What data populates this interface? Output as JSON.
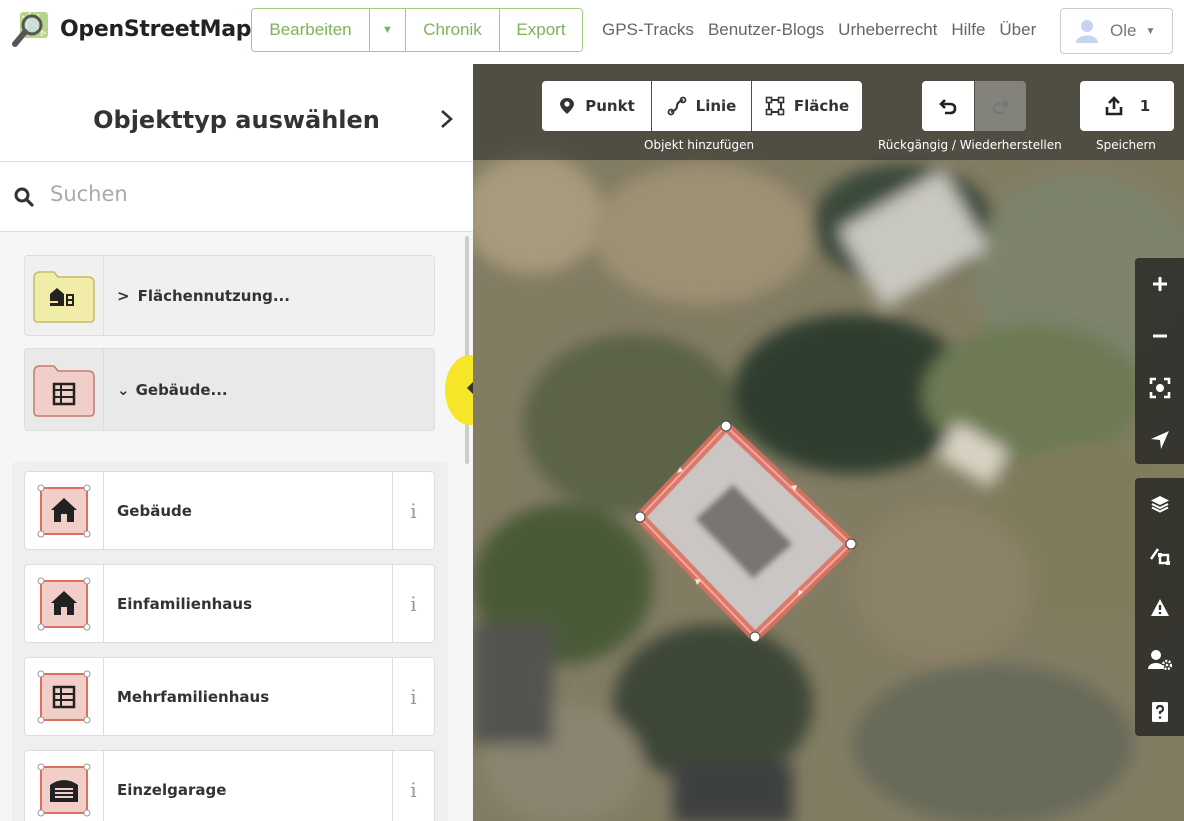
{
  "app": {
    "logo_text": "OpenStreetMap"
  },
  "top_nav": {
    "edit": "Bearbeiten",
    "history": "Chronik",
    "export": "Export",
    "links": [
      "GPS-Tracks",
      "Benutzer-Blogs",
      "Urheberrecht",
      "Hilfe",
      "Über"
    ],
    "user": "Ole"
  },
  "sidebar": {
    "title": "Objekttyp auswählen",
    "search_placeholder": "Suchen",
    "categories": [
      {
        "label": "Flächennutzung...",
        "expanded": false,
        "icon": "landuse-folder-icon"
      },
      {
        "label": "Gebäude...",
        "expanded": true,
        "icon": "building-folder-icon"
      }
    ],
    "presets": [
      {
        "label": "Gebäude",
        "icon": "house-icon"
      },
      {
        "label": "Einfamilienhaus",
        "icon": "house-icon"
      },
      {
        "label": "Mehrfamilienhaus",
        "icon": "apartment-icon"
      },
      {
        "label": "Einzelgarage",
        "icon": "garage-icon"
      }
    ],
    "info_glyph": "i"
  },
  "map_toolbar": {
    "point": "Punkt",
    "line": "Linie",
    "area": "Fläche",
    "add_caption": "Objekt hinzufügen",
    "undo_caption": "Rückgängig / Wiederherstellen",
    "save_count": "1",
    "save_caption": "Speichern"
  },
  "map_controls": [
    "zoom-in-icon",
    "zoom-out-icon",
    "zoom-to-selection-icon",
    "geolocate-icon",
    "layers-icon",
    "map-data-icon",
    "issues-icon",
    "preferences-icon",
    "help-icon"
  ],
  "colors": {
    "accent_green": "#7eb258",
    "building_red": "#e06e5f",
    "preset_pink": "#f2cec8",
    "landuse_yellow": "#f1eca8"
  }
}
